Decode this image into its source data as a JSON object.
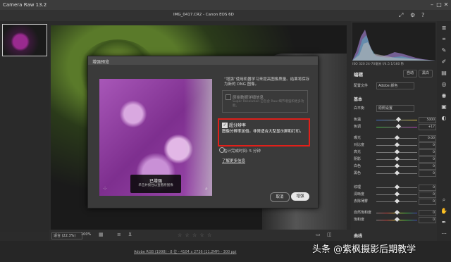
{
  "app": {
    "title": "Camera Raw 13.2"
  },
  "topbar": {
    "filename": "IMG_0417.CR2 - Canon EOS 6D"
  },
  "dialog": {
    "title": "增强预览",
    "description": "“增强”使用机器学习来提高图像质量。结果将保存为新的 DNG 图像。",
    "raw_details_label": "原始数据详细信息",
    "raw_details_sub": "Super Resolution 已包含 Raw 细节增强和更多功能。",
    "super_res_label": "超分辨率",
    "super_res_desc": "图像分辨率加倍。非常适合大型显示屏和打印。",
    "est_time": "估计完成时间: 5 分钟",
    "learn_more": "了解更多信息",
    "preview_badge_title": "已增强",
    "preview_badge_sub": "单击并按住以查看原图像",
    "cancel": "取消",
    "enhance": "增强"
  },
  "bottombar": {
    "zoom_fit": "适合 (22.3%)",
    "zoom_pct": "100%",
    "stars": "☆ ☆ ☆ ☆ ☆"
  },
  "statusbar": {
    "info": "Adobe RGB (1998) - 8 位 - 4104 x 2736 (11.2MP) - 300 ppi"
  },
  "watermark": "头条 @紫枫摄影后期教学",
  "rightpanel": {
    "camera_info": "ISO 320   24-70毫米   f/4.5   1/160 秒",
    "edit_label": "编辑",
    "auto_btn": "自动",
    "bw_btn": "黑白",
    "profile_label": "配置文件",
    "profile_value": "Adobe 颜色",
    "basic_header": "基本",
    "wb_label": "白平衡",
    "wb_value": "原照设置",
    "sliders": [
      {
        "label": "色温",
        "value": "5000",
        "pos": 0.55
      },
      {
        "label": "色调",
        "value": "+17",
        "pos": 0.55
      },
      {
        "label": "曝光",
        "value": "0.00",
        "pos": 0.5
      },
      {
        "label": "对比度",
        "value": "0",
        "pos": 0.5
      },
      {
        "label": "高光",
        "value": "0",
        "pos": 0.5
      },
      {
        "label": "阴影",
        "value": "0",
        "pos": 0.5
      },
      {
        "label": "白色",
        "value": "0",
        "pos": 0.5
      },
      {
        "label": "黑色",
        "value": "0",
        "pos": 0.5
      },
      {
        "label": "纹理",
        "value": "0",
        "pos": 0.5
      },
      {
        "label": "清晰度",
        "value": "0",
        "pos": 0.5
      },
      {
        "label": "去除薄雾",
        "value": "0",
        "pos": 0.5
      },
      {
        "label": "自然饱和度",
        "value": "0",
        "pos": 0.5
      },
      {
        "label": "饱和度",
        "value": "0",
        "pos": 0.5
      }
    ],
    "curve_header": "曲线"
  },
  "icons": [
    "zoom-icon",
    "crop-icon",
    "brush-icon",
    "settings-icon",
    "help-icon"
  ]
}
